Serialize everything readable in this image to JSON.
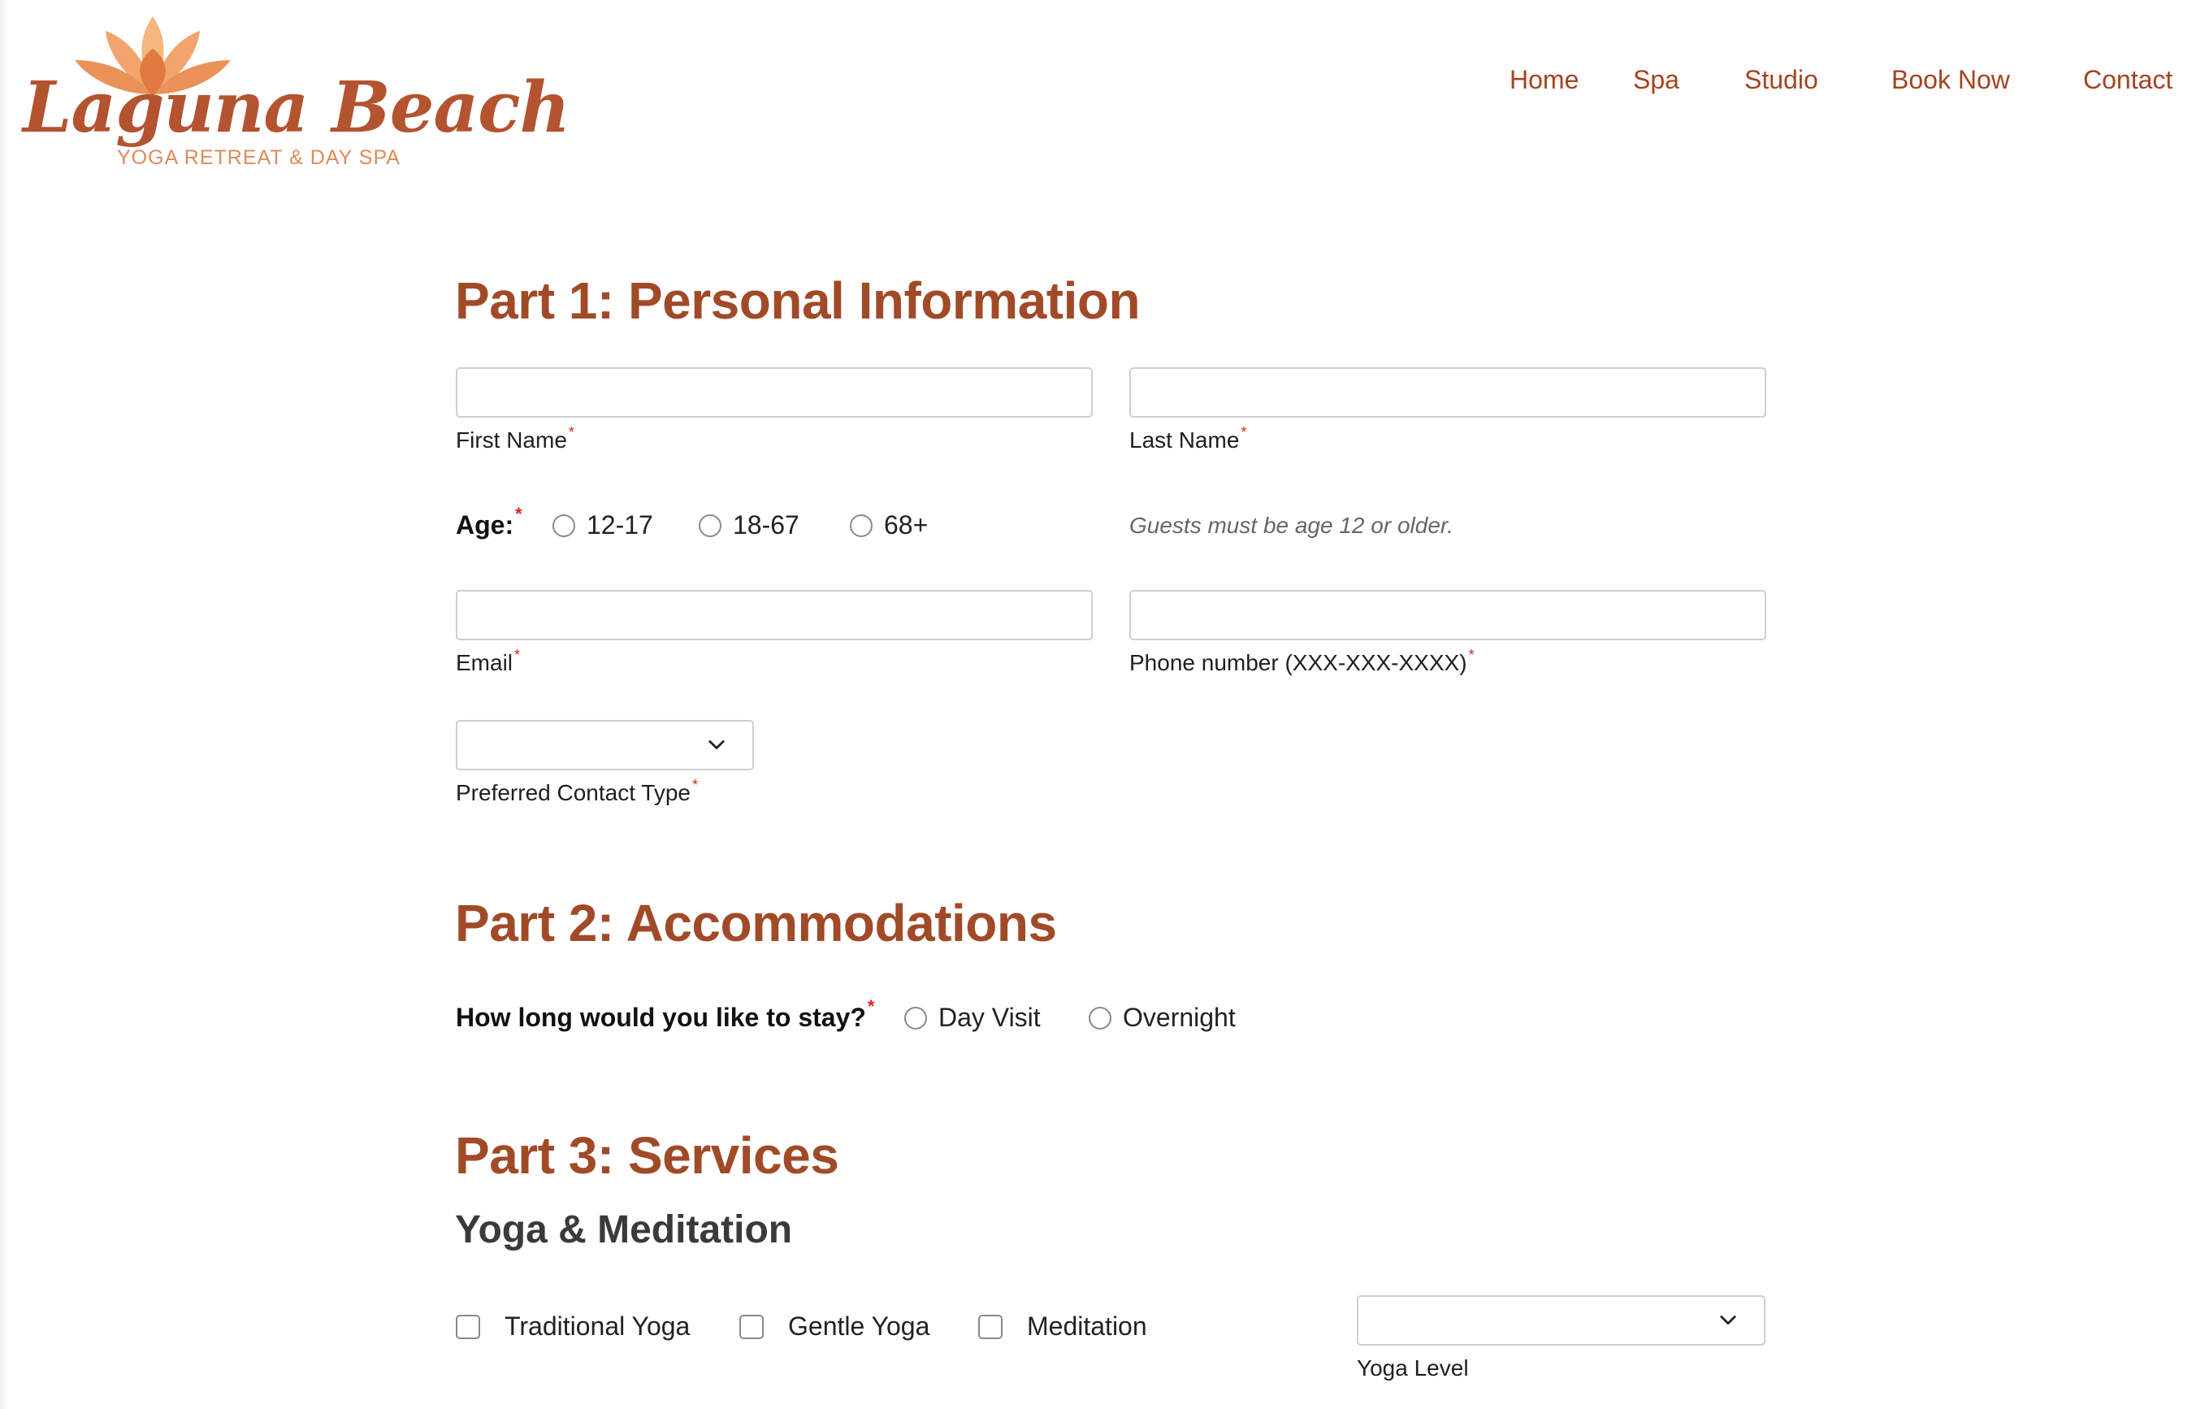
{
  "brand": {
    "name": "Laguna Beach",
    "tagline": "YOGA RETREAT & DAY SPA"
  },
  "nav": {
    "items": [
      "Home",
      "Spa",
      "Studio",
      "Book Now",
      "Contact"
    ]
  },
  "colors": {
    "accent": "#a14a28",
    "nav": "#a5431f",
    "required": "#dd2222",
    "logo_light": "#f4b77e"
  },
  "part1": {
    "title": "Part 1: Personal Information",
    "first_name": {
      "label": "First Name",
      "value": ""
    },
    "last_name": {
      "label": "Last Name",
      "value": ""
    },
    "age": {
      "label": "Age:",
      "options": [
        "12-17",
        "18-67",
        "68+"
      ],
      "note": "Guests must be age 12 or older."
    },
    "email": {
      "label": "Email",
      "value": ""
    },
    "phone": {
      "label": "Phone number (XXX-XXX-XXXX)",
      "value": ""
    },
    "contact_type": {
      "label": "Preferred Contact Type",
      "value": ""
    },
    "required_mark": "*"
  },
  "part2": {
    "title": "Part 2: Accommodations",
    "stay": {
      "label": "How long would you like to stay?",
      "options": [
        "Day Visit",
        "Overnight"
      ]
    }
  },
  "part3": {
    "title": "Part 3: Services",
    "yoga": {
      "heading": "Yoga & Meditation",
      "options": [
        "Traditional Yoga",
        "Gentle Yoga",
        "Meditation"
      ],
      "level": {
        "label": "Yoga Level",
        "value": ""
      }
    }
  },
  "icons": {
    "logo": "lotus-icon",
    "dropdown": "chevron-down-icon"
  }
}
